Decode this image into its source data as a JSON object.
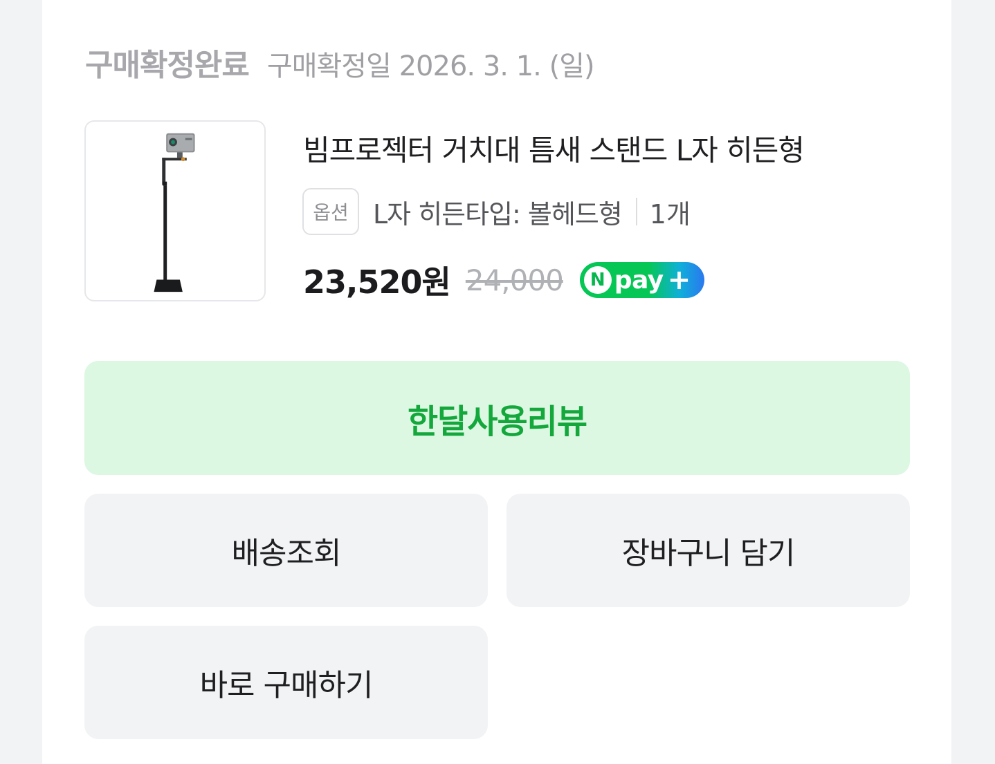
{
  "order": {
    "status": "구매확정완료",
    "confirm_date": "구매확정일 2026. 3. 1. (일)"
  },
  "product": {
    "thumbnail_alt": "projector stand",
    "name": "빔프로젝터 거치대 틈새 스탠드 L자 히든형",
    "option_badge": "옵션",
    "option_text": "L자 히든타입: 볼헤드형",
    "quantity": "1개",
    "price": "23,520원",
    "original_price": "24,000",
    "npay_letter": "N",
    "npay_text": "pay",
    "npay_plus": "+"
  },
  "actions": {
    "review": "한달사용리뷰",
    "shipping": "배송조회",
    "cart": "장바구니 담기",
    "buy_now": "바로 구매하기"
  },
  "colors": {
    "review_bg": "#dcf7e2",
    "review_text": "#14a83c",
    "button_bg": "#f2f3f5",
    "npay_green": "#06c755"
  }
}
